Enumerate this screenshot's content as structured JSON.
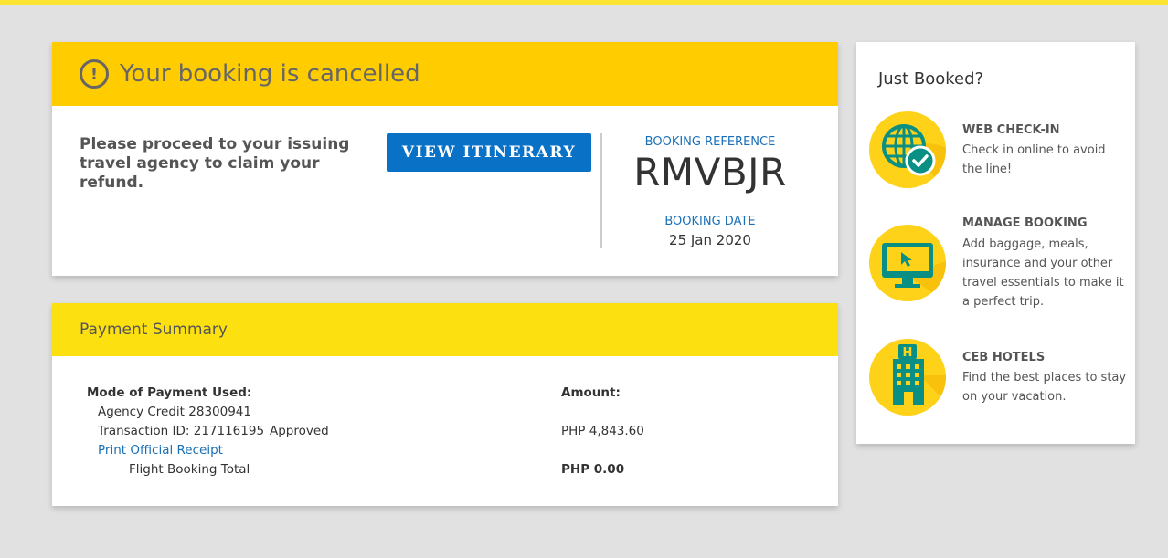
{
  "cancel": {
    "title": "Your booking is cancelled",
    "message": "Please proceed to your issuing travel agency to claim your refund.",
    "view_itinerary": "VIEW ITINERARY",
    "ref_label": "BOOKING REFERENCE",
    "ref_code": "RMVBJR",
    "date_label": "BOOKING DATE",
    "date_value": "25 Jan 2020"
  },
  "payment": {
    "title": "Payment Summary",
    "mode_label": "Mode of Payment Used:",
    "amount_label": "Amount:",
    "agency_credit": "Agency Credit 28300941",
    "transaction": "Transaction ID: 217116195",
    "status": "Approved",
    "transaction_amount": "PHP 4,843.60",
    "receipt_link": "Print Official Receipt",
    "total_label": "Flight Booking Total",
    "total_amount": "PHP 0.00"
  },
  "side": {
    "title": "Just Booked?",
    "items": [
      {
        "icon": "globe-check-icon",
        "heading": "WEB CHECK-IN",
        "desc": "Check in online to avoid the line!"
      },
      {
        "icon": "monitor-cursor-icon",
        "heading": "MANAGE BOOKING",
        "desc": "Add baggage, meals, insurance and your other travel essentials to make it a perfect trip."
      },
      {
        "icon": "hotel-icon",
        "heading": "CEB HOTELS",
        "desc": "Find the best places to stay on your vacation."
      }
    ]
  },
  "colors": {
    "accent_yellow": "#ffcc00",
    "header_yellow": "#fde00f",
    "link_blue": "#1a6fb6",
    "button_blue": "#0a72c6",
    "icon_teal": "#0a8f84"
  }
}
